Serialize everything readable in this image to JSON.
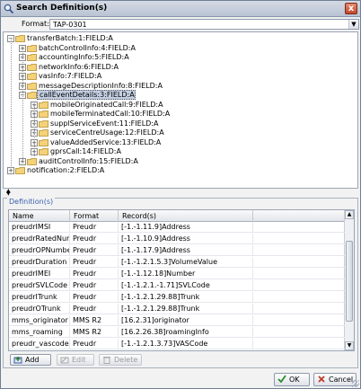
{
  "window": {
    "title": "Search Definition(s)",
    "close_glyph": "x"
  },
  "format": {
    "label": "Format:",
    "value": "TAP-0301"
  },
  "tree": [
    {
      "label": "transferBatch:1:FIELD:A",
      "level": 0,
      "expanded": true
    },
    {
      "label": "batchControlInfo:4:FIELD:A",
      "level": 1,
      "expanded": false
    },
    {
      "label": "accountingInfo:5:FIELD:A",
      "level": 1,
      "expanded": false
    },
    {
      "label": "networkInfo:6:FIELD:A",
      "level": 1,
      "expanded": false
    },
    {
      "label": "vasInfo:7:FIELD:A",
      "level": 1,
      "expanded": false
    },
    {
      "label": "messageDescriptionInfo:8:FIELD:A",
      "level": 1,
      "expanded": false
    },
    {
      "label": "callEventDetails:3:FIELD:A",
      "level": 1,
      "expanded": true,
      "selected": true
    },
    {
      "label": "mobileOriginatedCall:9:FIELD:A",
      "level": 2,
      "expanded": false
    },
    {
      "label": "mobileTerminatedCall:10:FIELD:A",
      "level": 2,
      "expanded": false
    },
    {
      "label": "supplServiceEvent:11:FIELD:A",
      "level": 2,
      "expanded": false
    },
    {
      "label": "serviceCentreUsage:12:FIELD:A",
      "level": 2,
      "expanded": false
    },
    {
      "label": "valueAddedService:13:FIELD:A",
      "level": 2,
      "expanded": false
    },
    {
      "label": "gprsCall:14:FIELD:A",
      "level": 2,
      "expanded": false
    },
    {
      "label": "auditControlInfo:15:FIELD:A",
      "level": 1,
      "expanded": false
    },
    {
      "label": "notification:2:FIELD:A",
      "level": 0,
      "expanded": false
    }
  ],
  "definitions": {
    "legend": "Definition(s)",
    "columns": [
      "Name",
      "Format",
      "Record(s)"
    ],
    "rows": [
      [
        "preudrIMSI",
        "Preudr",
        "[-1.-1.11.9]Address"
      ],
      [
        "preudrRatedNum...",
        "Preudr",
        "[-1.-1.10.9]Address"
      ],
      [
        "preudrOPNumber",
        "Preudr",
        "[-1.-1.17.9]Address"
      ],
      [
        "preudrDuration",
        "Preudr",
        "[-1.-1.2.1.5.3]VolumeValue"
      ],
      [
        "preudrIMEI",
        "Preudr",
        "[-1.-1.12.18]Number"
      ],
      [
        "preudrSVLCode",
        "Preudr",
        "[-1.-1.2.1.-1.71]SVLCode"
      ],
      [
        "preudrITrunk",
        "Preudr",
        "[-1.-1.2.1.29.88]Trunk"
      ],
      [
        "preudrOTrunk",
        "Preudr",
        "[-1.-1.2.1.29.88]Trunk"
      ],
      [
        "mms_originator",
        "MMS R2",
        "[16.2.31]originator"
      ],
      [
        "mms_roaming",
        "MMS R2",
        "[16.2.26.38]roamingInfo"
      ],
      [
        "preudr_vascode",
        "Preudr",
        "[-1.-1.2.1.3.73]VASCode"
      ]
    ],
    "buttons": {
      "add": "Add",
      "edit": "Edit",
      "delete": "Delete"
    }
  },
  "footer": {
    "ok": "OK",
    "cancel": "Cancel"
  }
}
